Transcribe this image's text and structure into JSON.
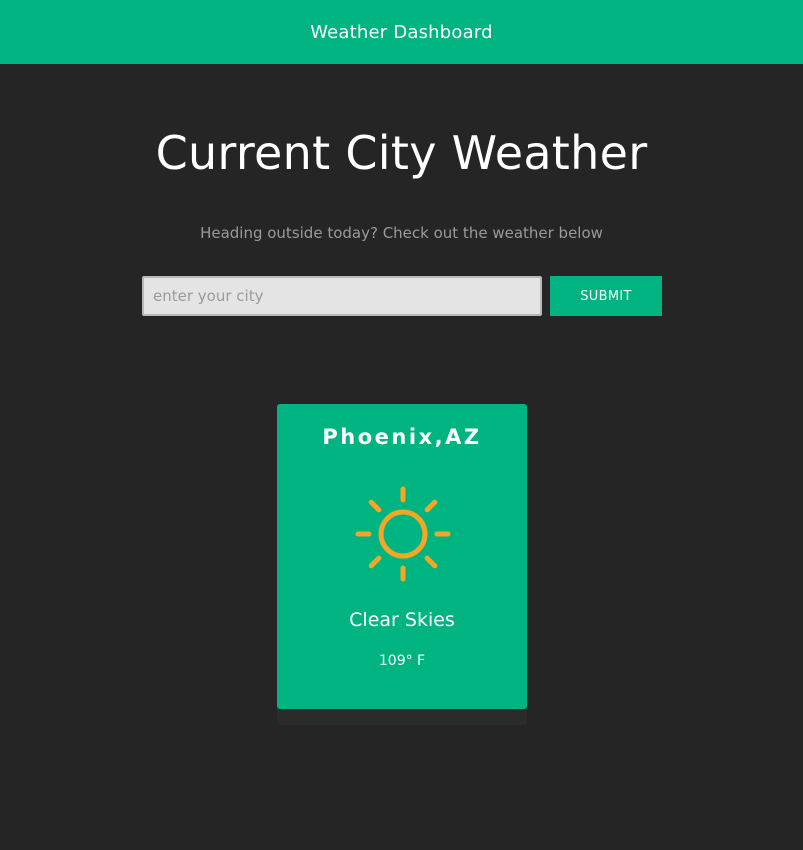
{
  "header": {
    "title": "Weather Dashboard"
  },
  "main": {
    "title": "Current City Weather",
    "subtitle": "Heading outside today? Check out the weather below"
  },
  "search": {
    "placeholder": "enter your city",
    "value": "",
    "submit_label": "SUBMIT"
  },
  "card": {
    "city": "Phoenix,AZ",
    "icon": "sun-icon",
    "condition": "Clear Skies",
    "temperature": "109° F"
  },
  "colors": {
    "accent": "#00b482",
    "background": "#252525",
    "sun": "#f5a623",
    "subtitle": "#9a9a9a"
  }
}
